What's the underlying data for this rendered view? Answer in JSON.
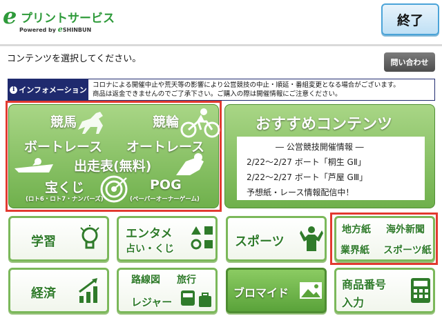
{
  "header": {
    "logo_mark": "e",
    "logo_title": "プリントサービス",
    "logo_powered": "Powered by",
    "logo_powered_e": "e",
    "logo_powered_brand": "SHINBUN",
    "end_button": "終了"
  },
  "instruction": "コンテンツを選択してください。",
  "contact_button": "問い合わせ",
  "info": {
    "label": "インフォメーション",
    "line1": "コロナによる開催中止や荒天等の影響により公営競技の中止・順延・番組変更となる場合がございます。",
    "line2": "商品は返金できませんのでご了承下さい。ご購入の際は開催情報にご注意ください。"
  },
  "main_tile": {
    "keiba": "競馬",
    "keirin": "競輪",
    "boat": "ボートレース",
    "auto": "オートレース",
    "shussohyo": "出走表(無料)",
    "takarakuji": "宝くじ",
    "takarakuji_sub": "(ロト6・ロト7・ナンバーズ)",
    "pog": "POG",
    "pog_sub": "(ペーパーオーナーゲーム)"
  },
  "recommend": {
    "title": "おすすめコンテンツ",
    "heading": "― 公営競技開催情報 ―",
    "lines": [
      "2/22〜2/27 ボート「桐生 GⅡ」",
      "2/22〜2/27 ボート「芦屋 GⅢ」",
      "予想紙・レース情報配信中！"
    ]
  },
  "tiles": {
    "study": "学習",
    "entame1": "エンタメ",
    "entame2": "占い・くじ",
    "sports": "スポーツ",
    "newspaper_chiho": "地方紙",
    "newspaper_kaigai": "海外新聞",
    "newspaper_gyokai": "業界紙",
    "newspaper_sports": "スポーツ紙",
    "keizai": "経済",
    "rosen": "路線図",
    "ryoko": "旅行",
    "leisure": "レジャー",
    "bromide": "ブロマイド",
    "product1": "商品番号",
    "product2": "入力"
  },
  "colors": {
    "brand_green": "#2e9a3a",
    "tile_green": "#6fb04c",
    "highlight_red": "#e23a30",
    "info_navy": "#1f2a6e",
    "end_blue": "#4aa3d8"
  }
}
